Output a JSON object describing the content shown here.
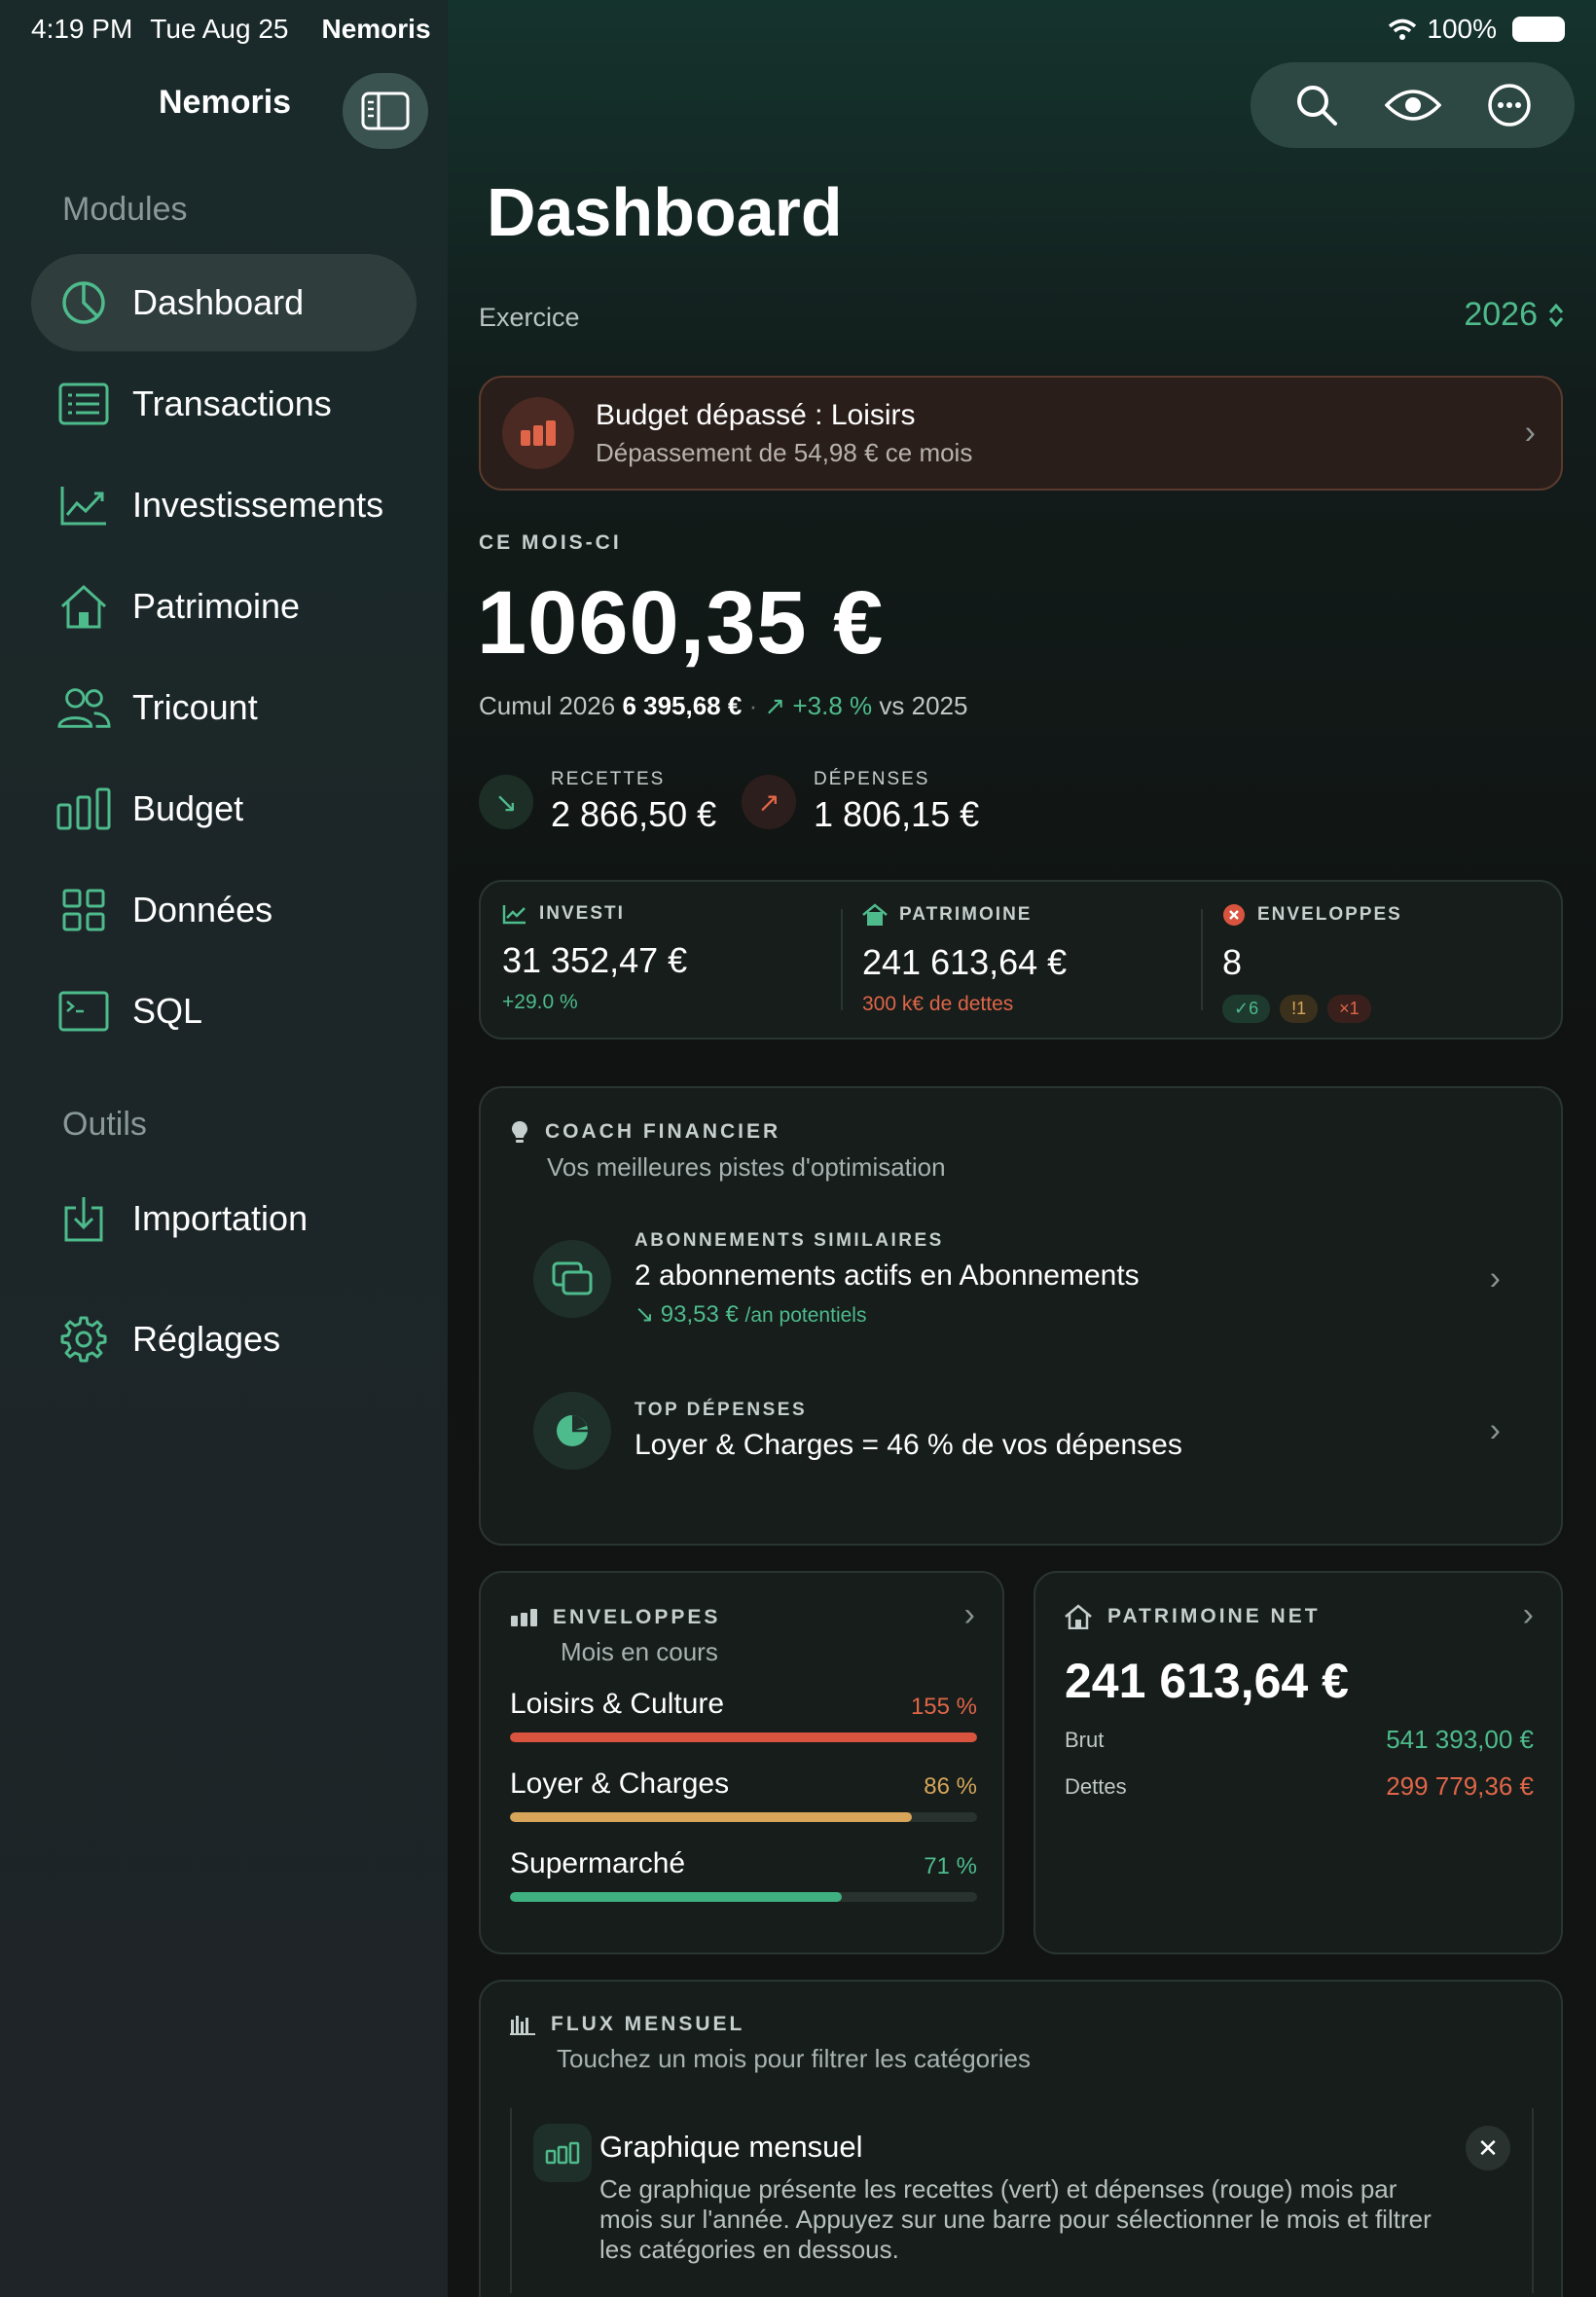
{
  "status_bar": {
    "time": "4:19 PM",
    "date": "Tue Aug 25",
    "app": "Nemoris",
    "battery": "100%"
  },
  "sidebar": {
    "title": "Nemoris",
    "sections": [
      {
        "label": "Modules"
      },
      {
        "label": "Outils"
      }
    ],
    "items": [
      {
        "label": "Dashboard",
        "icon": "pie-chart-icon"
      },
      {
        "label": "Transactions",
        "icon": "list-icon"
      },
      {
        "label": "Investissements",
        "icon": "trend-chart-icon"
      },
      {
        "label": "Patrimoine",
        "icon": "house-icon"
      },
      {
        "label": "Tricount",
        "icon": "people-icon"
      },
      {
        "label": "Budget",
        "icon": "bars-icon"
      },
      {
        "label": "Données",
        "icon": "grid-icon"
      },
      {
        "label": "SQL",
        "icon": "terminal-icon"
      },
      {
        "label": "Importation",
        "icon": "import-icon"
      },
      {
        "label": "Réglages",
        "icon": "gear-icon"
      }
    ]
  },
  "header": {
    "title": "Dashboard",
    "exercice_label": "Exercice",
    "year": "2026"
  },
  "alert": {
    "title": "Budget dépassé : Loisirs",
    "subtitle": "Dépassement de 54,98 € ce mois"
  },
  "month": {
    "label": "CE MOIS-CI",
    "amount": "1060,35 €",
    "cumul_label": "Cumul 2026",
    "cumul_value": "6 395,68 €",
    "separator": "·",
    "change": "↗ +3.8 %",
    "vs": "vs 2025"
  },
  "flows": {
    "income": {
      "label": "RECETTES",
      "value": "2 866,50 €",
      "arrow": "↘"
    },
    "expense": {
      "label": "DÉPENSES",
      "value": "1 806,15 €",
      "arrow": "↗"
    }
  },
  "kpis": {
    "investi": {
      "label": "INVESTI",
      "value": "31 352,47 €",
      "sub": "+29.0 %"
    },
    "patrimoine": {
      "label": "PATRIMOINE",
      "value": "241 613,64 €",
      "sub": "300 k€ de dettes"
    },
    "enveloppes": {
      "label": "ENVELOPPES",
      "value": "8",
      "ok": "✓6",
      "warn": "!1",
      "over": "×1"
    }
  },
  "coach": {
    "label": "COACH FINANCIER",
    "subtitle": "Vos meilleures pistes d'optimisation",
    "tips": [
      {
        "caption": "ABONNEMENTS SIMILAIRES",
        "title": "2 abonnements actifs en Abonnements",
        "amount": "↘ 93,53 €",
        "amount_suffix": "/an potentiels"
      },
      {
        "caption": "TOP DÉPENSES",
        "title": "Loyer & Charges = 46 % de vos dépenses"
      }
    ]
  },
  "envelopes": {
    "label": "ENVELOPPES",
    "subtitle": "Mois en cours",
    "rows": [
      {
        "name": "Loisirs & Culture",
        "percent_label": "155 %",
        "percent": 155,
        "color": "#d9543f"
      },
      {
        "name": "Loyer & Charges",
        "percent_label": "86 %",
        "percent": 86,
        "color": "#d6a55a"
      },
      {
        "name": "Supermarché",
        "percent_label": "71 %",
        "percent": 71,
        "color": "#3fb07f"
      }
    ]
  },
  "net_worth": {
    "label": "PATRIMOINE NET",
    "value": "241 613,64 €",
    "brut_label": "Brut",
    "brut_value": "541 393,00 €",
    "dettes_label": "Dettes",
    "dettes_value": "299 779,36 €"
  },
  "flux": {
    "label": "FLUX MENSUEL",
    "subtitle": "Touchez un mois pour filtrer les catégories",
    "help_title": "Graphique mensuel",
    "help_body": "Ce graphique présente les recettes (vert) et dépenses (rouge) mois par mois sur l'année. Appuyez sur une barre pour sélectionner le mois et filtrer les catégories en dessous."
  },
  "colors": {
    "accent": "#4ebb8c",
    "danger": "#d9543f",
    "warning": "#d6a55a"
  }
}
